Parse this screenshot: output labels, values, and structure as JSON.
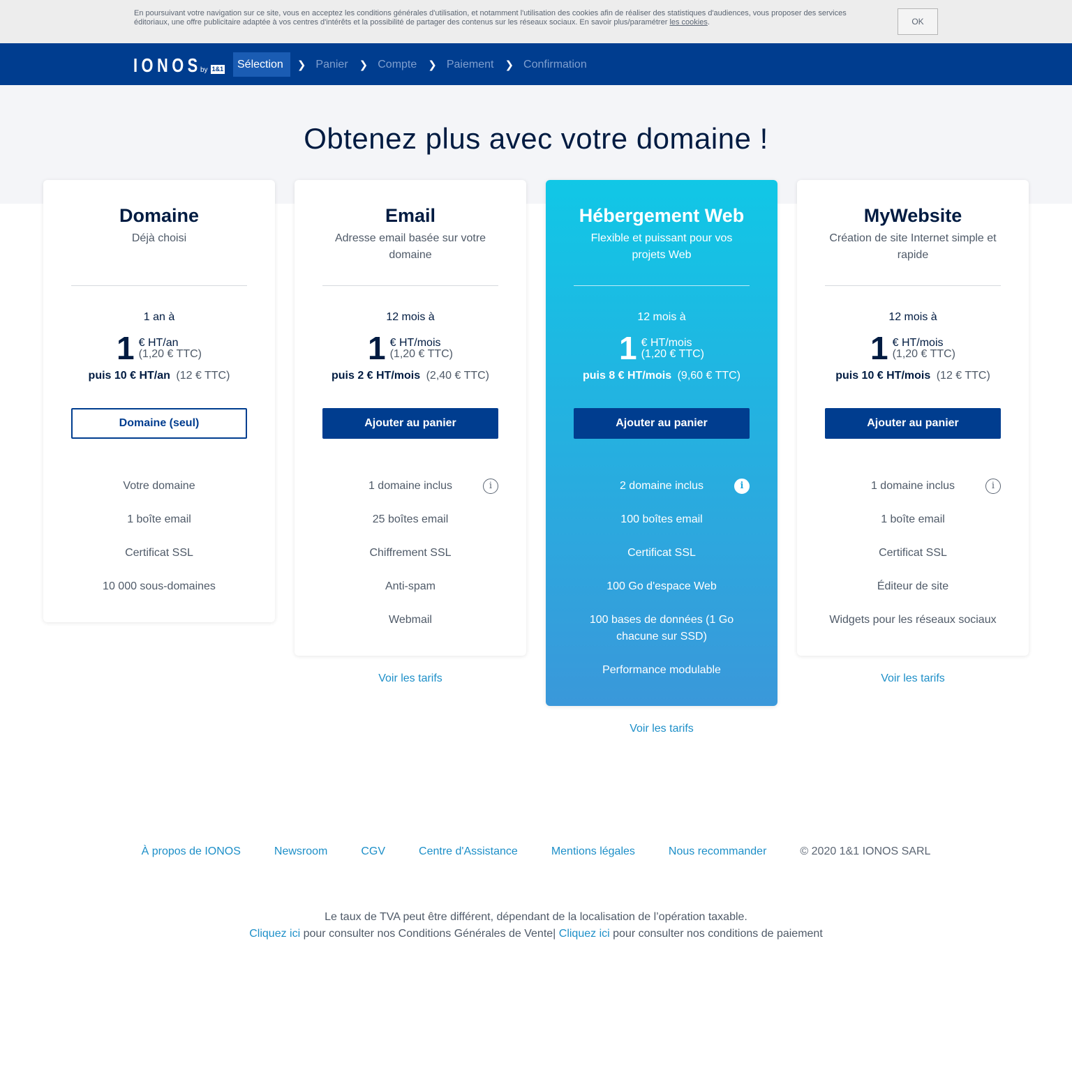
{
  "cookie": {
    "text": "En poursuivant votre navigation sur ce site, vous en acceptez les conditions générales d'utilisation, et notamment l'utilisation des cookies afin de réaliser des statistiques d'audiences, vous proposer des services éditoriaux, une offre publicitaire adaptée à vos centres d'intérêts et la possibilité de partager des contenus sur les réseaux sociaux. En savoir plus/paramétrer ",
    "link": "les cookies",
    "end": ".",
    "ok": "OK"
  },
  "header": {
    "logo": "IONOS",
    "logo_by": "by",
    "logo_brand": "1&1",
    "steps": [
      "Sélection",
      "Panier",
      "Compte",
      "Paiement",
      "Confirmation"
    ]
  },
  "main": {
    "title": "Obtenez plus avec votre domaine !"
  },
  "cards": [
    {
      "title": "Domaine",
      "subtitle": "Déjà choisi",
      "period": "1 an à",
      "price": "1",
      "unit": "€ HT/an",
      "ttc": "(1,20 € TTC)",
      "then_bold": "puis 10 € HT/an",
      "then_ttc": "(12 € TTC)",
      "button": "Domaine (seul)",
      "features": [
        "Votre domaine",
        "1 boîte email",
        "Certificat SSL",
        "10 000 sous-domaines"
      ]
    },
    {
      "title": "Email",
      "subtitle": "Adresse email basée sur votre domaine",
      "period": "12 mois à",
      "price": "1",
      "unit": "€ HT/mois",
      "ttc": "(1,20 € TTC)",
      "then_bold": "puis 2 € HT/mois",
      "then_ttc": "(2,40 € TTC)",
      "button": "Ajouter au panier",
      "features": [
        "1 domaine inclus",
        "25 boîtes email",
        "Chiffrement SSL",
        "Anti-spam",
        "Webmail"
      ],
      "tarifs": "Voir les tarifs"
    },
    {
      "title": "Hébergement Web",
      "subtitle": "Flexible et puissant pour vos projets Web",
      "period": "12 mois à",
      "price": "1",
      "unit": "€ HT/mois",
      "ttc": "(1,20 € TTC)",
      "then_bold": "puis 8 € HT/mois",
      "then_ttc": "(9,60 € TTC)",
      "button": "Ajouter au panier",
      "features": [
        "2 domaine inclus",
        "100 boîtes email",
        "Certificat SSL",
        "100 Go d'espace Web",
        "100 bases de données (1 Go chacune sur SSD)",
        "Performance modulable"
      ],
      "tarifs": "Voir les tarifs"
    },
    {
      "title": "MyWebsite",
      "subtitle": "Création de site Internet simple et rapide",
      "period": "12 mois à",
      "price": "1",
      "unit": "€ HT/mois",
      "ttc": "(1,20 € TTC)",
      "then_bold": "puis 10 € HT/mois",
      "then_ttc": "(12 € TTC)",
      "button": "Ajouter au panier",
      "features": [
        "1 domaine inclus",
        "1 boîte email",
        "Certificat SSL",
        "Éditeur de site",
        "Widgets pour les réseaux sociaux"
      ],
      "tarifs": "Voir les tarifs"
    }
  ],
  "info_glyph": "i",
  "footer": {
    "links": [
      "À propos de IONOS",
      "Newsroom",
      "CGV",
      "Centre d'Assistance",
      "Mentions légales",
      "Nous recommander"
    ],
    "copyright": "© 2020 1&1 IONOS SARL",
    "vat": "Le taux de TVA peut être différent, dépendant de la localisation de l’opération taxable.",
    "click_here": "Cliquez ici",
    "cgv_text": " pour consulter nos Conditions Générales de Vente| ",
    "payment_text": " pour consulter nos conditions de paiement"
  },
  "colors": {
    "header_bg": "#003d8f",
    "accent_blue": "#003d8f",
    "link": "#1d8fc8",
    "featured_top": "#11c7e6",
    "featured_bottom": "#3a98da"
  }
}
